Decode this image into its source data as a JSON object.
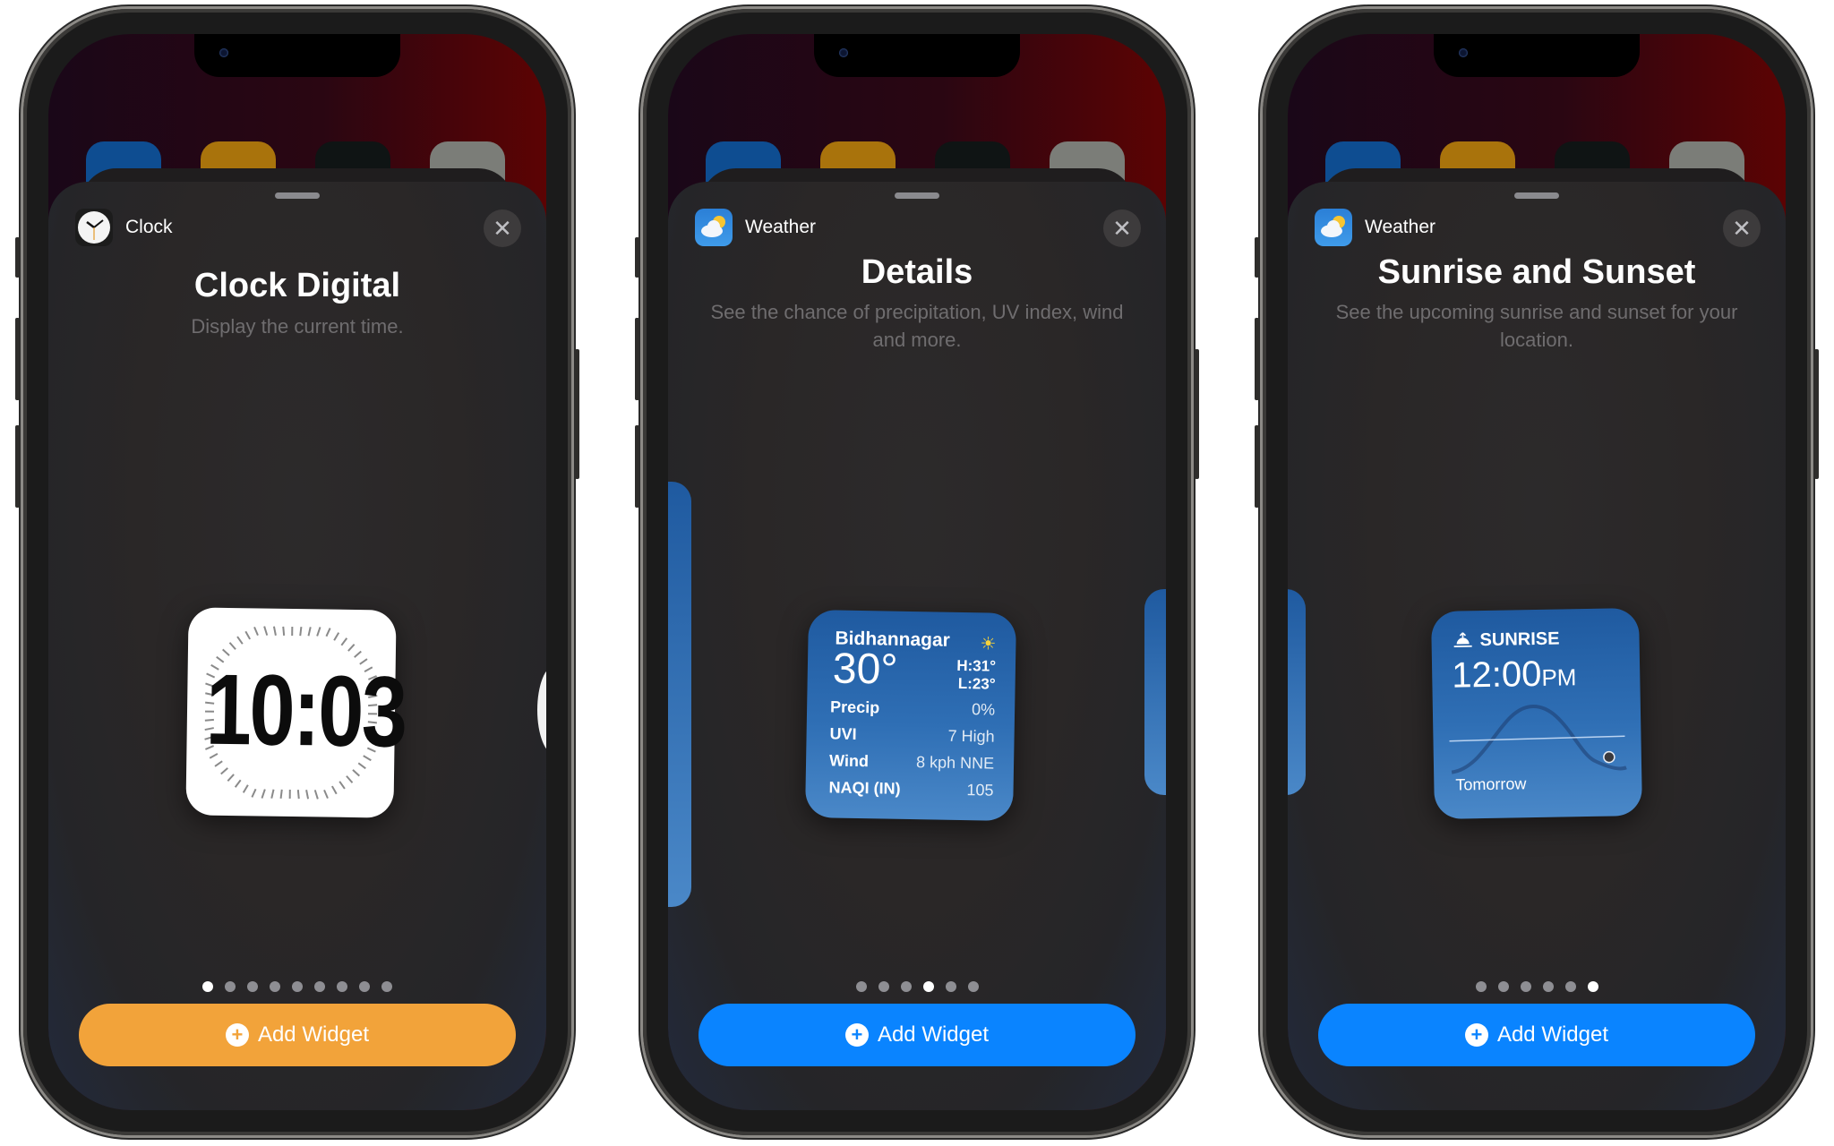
{
  "phones": [
    {
      "app_name": "Clock",
      "close_icon": "✕",
      "widget_title": "Clock Digital",
      "widget_description": "Display the current time.",
      "page_count": 9,
      "active_page": 1,
      "add_button_label": "Add Widget",
      "add_button_color": "#f2a33a",
      "widget": {
        "type": "clock-digital",
        "time": "10:03"
      }
    },
    {
      "app_name": "Weather",
      "close_icon": "✕",
      "widget_title": "Details",
      "widget_description": "See the chance of precipitation, UV index, wind and more.",
      "page_count": 6,
      "active_page": 4,
      "add_button_label": "Add Widget",
      "add_button_color": "#0a84ff",
      "widget": {
        "type": "weather-details",
        "location": "Bidhannagar",
        "temperature": "30°",
        "high": "H:31°",
        "low": "L:23°",
        "condition_icon": "sun-icon",
        "rows": [
          {
            "label": "Precip",
            "value": "0%"
          },
          {
            "label": "UVI",
            "value": "7 High"
          },
          {
            "label": "Wind",
            "value": "8 kph NNE"
          },
          {
            "label": "NAQI (IN)",
            "value": "105"
          }
        ]
      }
    },
    {
      "app_name": "Weather",
      "close_icon": "✕",
      "widget_title": "Sunrise and Sunset",
      "widget_description": "See the upcoming sunrise and sunset for your location.",
      "page_count": 6,
      "active_page": 6,
      "add_button_label": "Add Widget",
      "add_button_color": "#0a84ff",
      "widget": {
        "type": "sunrise-sunset",
        "label": "SUNRISE",
        "time": "12:00",
        "meridiem": "PM",
        "day": "Tomorrow"
      }
    }
  ],
  "plus_icon": "+"
}
